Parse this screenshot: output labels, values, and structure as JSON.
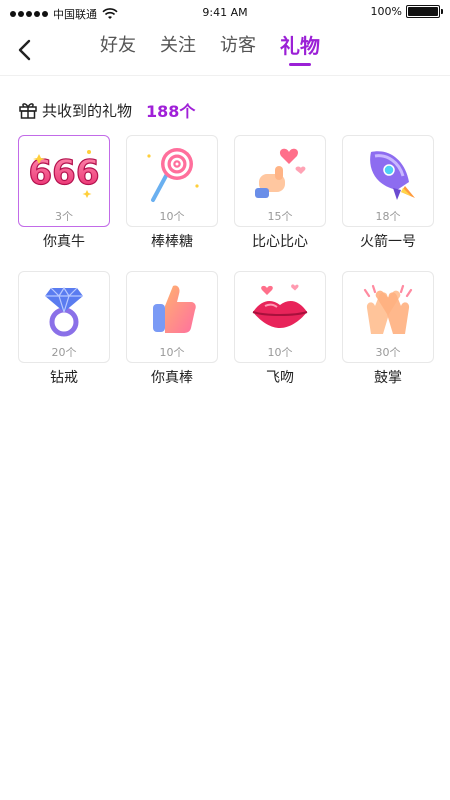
{
  "status_bar": {
    "carrier": "中国联通",
    "time": "9:41 AM",
    "battery": "100%"
  },
  "nav": {
    "tabs": [
      {
        "label": "好友",
        "active": false
      },
      {
        "label": "关注",
        "active": false
      },
      {
        "label": "访客",
        "active": false
      },
      {
        "label": "礼物",
        "active": true
      }
    ],
    "accent_color": "#9b20d6"
  },
  "summary": {
    "label": "共收到的礼物",
    "count": "188个"
  },
  "gifts": [
    {
      "name": "你真牛",
      "qty": "3个",
      "icon": "666-icon",
      "selected": true
    },
    {
      "name": "棒棒糖",
      "qty": "10个",
      "icon": "lollipop-icon",
      "selected": false
    },
    {
      "name": "比心比心",
      "qty": "15个",
      "icon": "finger-heart-icon",
      "selected": false
    },
    {
      "name": "火箭一号",
      "qty": "18个",
      "icon": "rocket-icon",
      "selected": false
    },
    {
      "name": "钻戒",
      "qty": "20个",
      "icon": "diamond-ring-icon",
      "selected": false
    },
    {
      "name": "你真棒",
      "qty": "10个",
      "icon": "thumbs-up-icon",
      "selected": false
    },
    {
      "name": "飞吻",
      "qty": "10个",
      "icon": "kiss-lips-icon",
      "selected": false
    },
    {
      "name": "鼓掌",
      "qty": "30个",
      "icon": "clapping-hands-icon",
      "selected": false
    }
  ]
}
